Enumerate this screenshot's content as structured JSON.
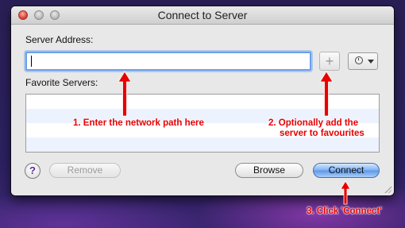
{
  "window": {
    "title": "Connect to Server"
  },
  "form": {
    "server_address_label": "Server Address:",
    "server_address_value": "",
    "favorite_servers_label": "Favorite Servers:",
    "add_label": "+"
  },
  "buttons": {
    "help_label": "?",
    "remove_label": "Remove",
    "browse_label": "Browse",
    "connect_label": "Connect"
  },
  "annotations": {
    "step1": "1. Enter the network path here",
    "step2_line1": "2. Optionally add the",
    "step2_line2": "server to favourites",
    "step3": "3. Click 'Connect'"
  },
  "icons": {
    "add": "plus-icon",
    "recent": "clock-icon",
    "popup": "chevron-down-icon"
  },
  "colors": {
    "annotation": "#e80000",
    "focus_ring": "#6aa0ea",
    "connect_button": "#7fb0f0"
  }
}
